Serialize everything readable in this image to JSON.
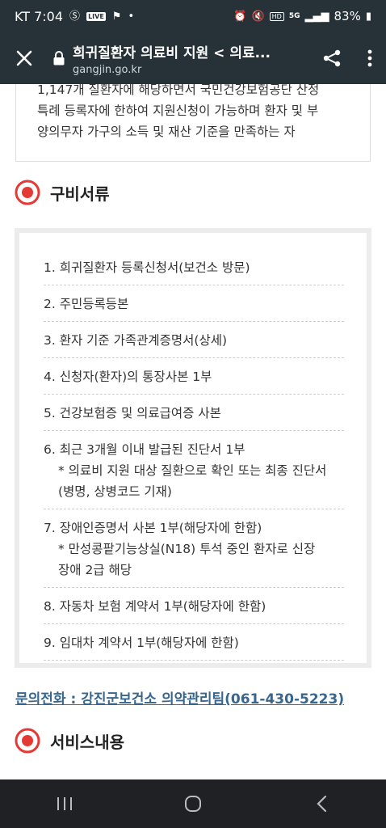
{
  "status_bar": {
    "time": "KT 7:04",
    "live_badge": "LIVE",
    "hd_badge": "HD",
    "network": "5G",
    "battery": "83%"
  },
  "browser": {
    "page_title": "희귀질환자 의료비 지원 < 의료...",
    "domain": "gangjin.go.kr"
  },
  "top_box": {
    "lines": [
      "1,147개 질환자에 해당하면서 국민건강보험공단 산정",
      "특례 등록자에 한하여 지원신청이 가능하며 환자 및 부",
      "양의무자 가구의 소득 및 재산 기준을 만족하는 자"
    ]
  },
  "section_documents": {
    "title": "구비서류",
    "items": [
      {
        "line": "1. 희귀질환자 등록신청서(보건소 방문)"
      },
      {
        "line": "2. 주민등록등본"
      },
      {
        "line": "3. 환자 기준 가족관계증명서(상세)"
      },
      {
        "line": "4. 신청자(환자)의 통장사본 1부"
      },
      {
        "line": "5. 건강보험증 및 의료급여증 사본"
      },
      {
        "line": "6. 최근 3개월 이내 발급된 진단서 1부",
        "sub1": "* 의료비 지원 대상 질환으로 확인 또는 최종 진단서",
        "sub2": "(병명, 상병코드 기재)"
      },
      {
        "line": "7. 장애인증명서 사본 1부(해당자에 한함)",
        "sub1": "* 만성콩팥기능상실(N18) 투석 중인 환자로 신장",
        "sub2": "장애 2급 해당"
      },
      {
        "line": "8. 자동차 보험 계약서 1부(해당자에 한함)"
      },
      {
        "line": "9. 임대차 계약서 1부(해당자에 한함)"
      }
    ]
  },
  "contact": {
    "text": "문의전화 : 강진군보건소 의약관리팀(061-430-5223)"
  },
  "section_service": {
    "title": "서비스내용"
  },
  "colors": {
    "bar_dark": "#263238",
    "accent_red": "#e53935",
    "link_blue": "#37668f"
  },
  "icons": [
    "close-icon",
    "lock-icon",
    "share-icon",
    "more-vert-icon",
    "target-icon",
    "recent-apps-icon",
    "home-icon",
    "back-icon"
  ]
}
